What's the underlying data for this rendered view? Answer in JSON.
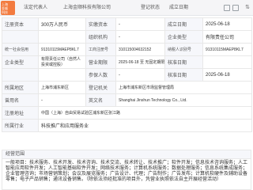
{
  "topbar": {
    "avatar_lines": [
      "上海",
      "金顺",
      "科技"
    ],
    "col1": "法定代表人",
    "col2": "上海金顺科技有限公司",
    "col3": "登记状态",
    "col4": "成立日期"
  },
  "rows": [
    {
      "k1": "注册资本",
      "v1": "300万人民币",
      "k2": "实缴资本",
      "v2": "-",
      "k3": "成立日期",
      "v3": "2025-06-18"
    },
    {
      "k1": "",
      "v1": "",
      "k2": "组织机构",
      "v2": "-",
      "k3": "企业类型",
      "v3": "有限责任公司"
    },
    {
      "k1": "统一社会信用",
      "v1": "91310115MAEP8KL7",
      "k2": "工商注册号",
      "v2": "310115004632152",
      "k3": "纳税人识别号",
      "v3": "91310115MAEP8KL7"
    },
    {
      "k1": "企业类型",
      "v1": "有限责任公司（自然人投资或控股）",
      "k2": "营业期限",
      "v2": "2025-06-18 至 无固定期限",
      "k3": "核准日期",
      "v3": ""
    },
    {
      "k1": "",
      "v1": "",
      "k2": "参保人数",
      "v2": "-",
      "k3": "核准日期",
      "v3": "2025-06-18"
    },
    {
      "k1": "所属地区",
      "v1": "上海市浦东新区",
      "k2": "登记机关",
      "v2": "上海市浦东新区市场监督管理局",
      "k3": "",
      "v3": ""
    },
    {
      "k1": "曾用名",
      "v1": "-",
      "k2": "英文名",
      "v2": "Shanghai Jinshun Technology Co., Ltd.",
      "k3": "",
      "v3": ""
    },
    {
      "k1": "注册地址",
      "v1": "中国（上海）自由贸易试验区浦东新区张江路",
      "k2": "",
      "v2": "",
      "k3": "",
      "v3": ""
    },
    {
      "k1": "所属行业",
      "v1": "科技推广和应用服务业",
      "k2": "",
      "v2": "",
      "k3": "",
      "v3": ""
    }
  ],
  "scope": {
    "label": "经营范围",
    "text": "一般项目：技术服务、技术开发、技术咨询、技术交流、技术转让、技术推广；软件开发；信息技术咨询服务；人工智能应用软件开发；人工智能基础软件开发；网络技术服务；计算机系统服务；数据处理服务；信息系统集成服务；企业管理咨询；市场营销策划；会议及展览服务；广告设计、代理；广告制作；广告发布；计算机软硬件及辅助设备零售；电子产品销售；通讯设备销售。（除依法须经批准的项目外，凭营业执照依法自主开展经营活动）"
  }
}
